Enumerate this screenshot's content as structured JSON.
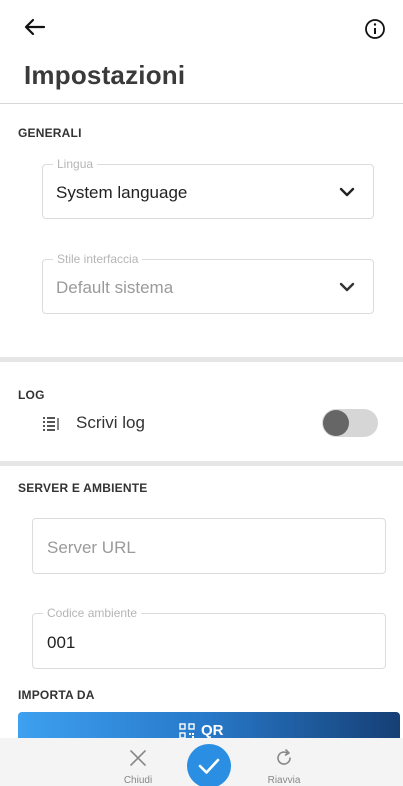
{
  "header": {
    "title": "Impostazioni",
    "back_icon": "arrow-left-icon",
    "info_icon": "info-circle-icon"
  },
  "generali": {
    "section_title": "GENERALI",
    "language": {
      "legend": "Lingua",
      "value": "System language"
    },
    "style": {
      "legend": "Stile interfaccia",
      "value": "Default sistema"
    }
  },
  "log": {
    "section_title": "LOG",
    "row_label": "Scrivi log",
    "row_icon": "log-list-icon",
    "enabled": false
  },
  "server": {
    "section_title": "SERVER E AMBIENTE",
    "server_url_placeholder": "Server URL",
    "environment": {
      "legend": "Codice ambiente",
      "value": "001"
    }
  },
  "import": {
    "section_title": "IMPORTA DA",
    "qr_label": "QR"
  },
  "bottom_nav": {
    "close_label": "Chiudi",
    "restart_label": "Riavvia"
  },
  "colors": {
    "accent": "#2a8fe3",
    "qr_gradient_start": "#3ea0f0",
    "qr_gradient_end": "#163f75"
  }
}
